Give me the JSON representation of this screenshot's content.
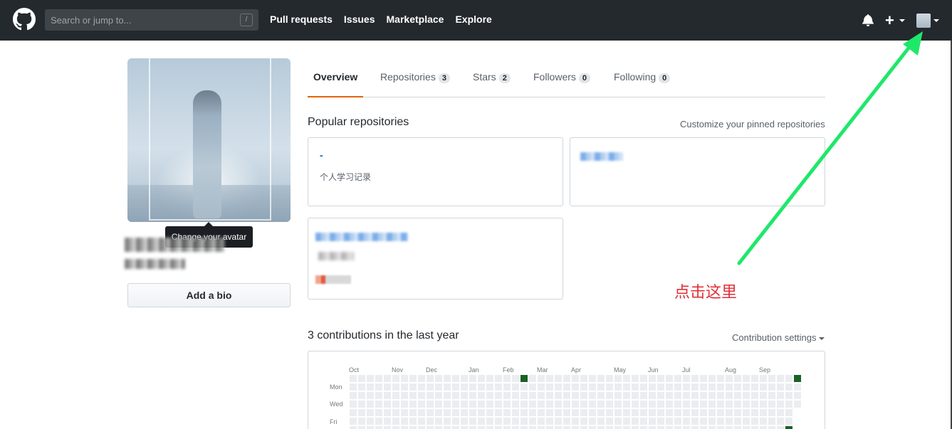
{
  "header": {
    "search_placeholder": "Search or jump to...",
    "slash_key": "/",
    "nav": [
      "Pull requests",
      "Issues",
      "Marketplace",
      "Explore"
    ],
    "plus": "+",
    "brand_color": "#24292e"
  },
  "profile": {
    "tooltip": "Change your avatar",
    "add_bio": "Add a bio"
  },
  "tabs": [
    {
      "label": "Overview",
      "count": null,
      "active": true
    },
    {
      "label": "Repositories",
      "count": "3"
    },
    {
      "label": "Stars",
      "count": "2"
    },
    {
      "label": "Followers",
      "count": "0"
    },
    {
      "label": "Following",
      "count": "0"
    }
  ],
  "pinned": {
    "title": "Popular repositories",
    "customize": "Customize your pinned repositories",
    "repos": [
      {
        "name": "-",
        "description": "个人学习记录"
      }
    ]
  },
  "annotation": {
    "text": "点击这里",
    "arrow_color": "#1ee86a",
    "text_color": "#e0303a"
  },
  "contributions": {
    "title": "3 contributions in the last year",
    "settings": "Contribution settings",
    "months": [
      "Oct",
      "Nov",
      "Dec",
      "Jan",
      "Feb",
      "Mar",
      "Apr",
      "May",
      "Jun",
      "Jul",
      "Aug",
      "Sep"
    ],
    "days": [
      "Mon",
      "Wed",
      "Fri"
    ],
    "empty_color": "#ebedf0",
    "active_color": "#196127"
  }
}
